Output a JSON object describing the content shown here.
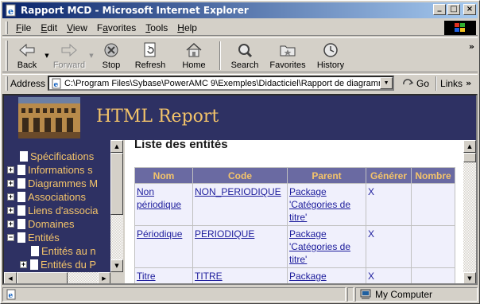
{
  "window": {
    "title": "Rapport MCD - Microsoft Internet Explorer",
    "controls": {
      "minimize": "_",
      "maximize": "□",
      "close": "×"
    }
  },
  "menubar": {
    "items": [
      {
        "label": "File",
        "accel": "F"
      },
      {
        "label": "Edit",
        "accel": "E"
      },
      {
        "label": "View",
        "accel": "V"
      },
      {
        "label": "Favorites",
        "accel": "a"
      },
      {
        "label": "Tools",
        "accel": "T"
      },
      {
        "label": "Help",
        "accel": "H"
      }
    ]
  },
  "toolbar": {
    "back": "Back",
    "forward": "Forward",
    "stop": "Stop",
    "refresh": "Refresh",
    "home": "Home",
    "search": "Search",
    "favorites": "Favorites",
    "history": "History",
    "more": "»"
  },
  "addressbar": {
    "label": "Address",
    "url": "C:\\Program Files\\Sybase\\PowerAMC 9\\Exemples\\Didacticiel\\Rapport de diagramm",
    "go": "Go",
    "links": "Links",
    "links_more": "»"
  },
  "banner": {
    "title": "HTML Report"
  },
  "tree": {
    "items": [
      {
        "label": "Spécifications",
        "expander": ""
      },
      {
        "label": "Informations s",
        "expander": "+"
      },
      {
        "label": "Diagrammes M",
        "expander": "+"
      },
      {
        "label": "Associations",
        "expander": "+"
      },
      {
        "label": "Liens d'associa",
        "expander": "+"
      },
      {
        "label": "Domaines",
        "expander": "+"
      },
      {
        "label": "Entités",
        "expander": "−"
      },
      {
        "label": "Entités au n",
        "expander": ""
      },
      {
        "label": "Entités du P",
        "expander": "+"
      }
    ]
  },
  "main": {
    "heading": "Liste des entités",
    "columns": [
      "Nom",
      "Code",
      "Parent",
      "Générer",
      "Nombre"
    ],
    "rows": [
      {
        "nom": "Non périodique",
        "code": "NON_PERIODIQUE",
        "parent": "Package 'Catégories de titre'",
        "generer": "X",
        "nombre": ""
      },
      {
        "nom": "Périodique",
        "code": "PERIODIQUE",
        "parent": "Package 'Catégories de titre'",
        "generer": "X",
        "nombre": ""
      },
      {
        "nom": "Titre",
        "code": "TITRE",
        "parent": "Package",
        "generer": "X",
        "nombre": ""
      }
    ]
  },
  "statusbar": {
    "text": "",
    "zone": "My Computer"
  },
  "colors": {
    "banner_bg": "#2e3163",
    "accent_gold": "#f4c46a",
    "table_header": "#6a6aa2",
    "link_blue": "#1c1c9c"
  }
}
